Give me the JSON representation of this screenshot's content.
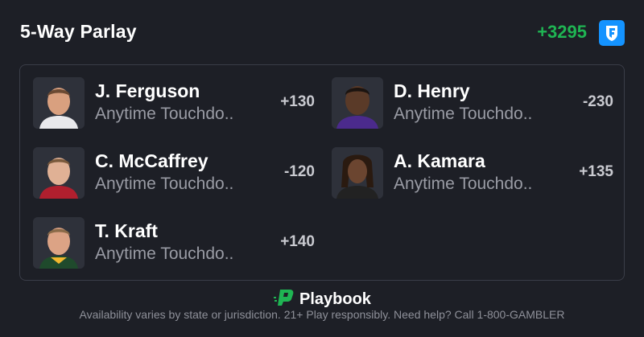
{
  "header": {
    "title": "5-Way Parlay",
    "total_odds": "+3295",
    "odds_color": "#1fb553",
    "book_icon": "fanduel-shield-icon",
    "book_color": "#1493ff"
  },
  "legs": [
    {
      "player": "J. Ferguson",
      "market": "Anytime Touchdo..",
      "odds": "+130",
      "avatar": "player-headshot-icon"
    },
    {
      "player": "D. Henry",
      "market": "Anytime Touchdo..",
      "odds": "-230",
      "avatar": "player-headshot-icon"
    },
    {
      "player": "C. McCaffrey",
      "market": "Anytime Touchdo..",
      "odds": "-120",
      "avatar": "player-headshot-icon"
    },
    {
      "player": "A. Kamara",
      "market": "Anytime Touchdo..",
      "odds": "+135",
      "avatar": "player-headshot-icon"
    },
    {
      "player": "T. Kraft",
      "market": "Anytime Touchdo..",
      "odds": "+140",
      "avatar": "player-headshot-icon"
    }
  ],
  "footer": {
    "brand": "Playbook",
    "brand_icon": "playbook-logo-icon",
    "brand_color": "#1fb553",
    "disclaimer": "Availability varies by state or jurisdiction. 21+ Play responsibly. Need help? Call 1-800-GAMBLER"
  }
}
